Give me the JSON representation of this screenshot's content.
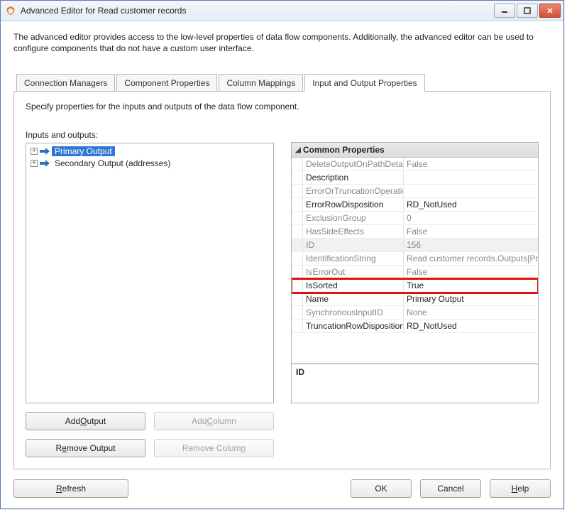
{
  "window": {
    "title": "Advanced Editor for Read customer records"
  },
  "intro": "The advanced editor provides access to the low-level properties of data flow components. Additionally, the advanced editor can be used to configure components that do not have a custom user interface.",
  "tabs": {
    "connection_managers": "Connection Managers",
    "component_properties": "Component Properties",
    "column_mappings": "Column Mappings",
    "io_properties": "Input and Output Properties"
  },
  "instruction": "Specify properties for the inputs and outputs of the data flow component.",
  "left": {
    "label": "Inputs and outputs:",
    "item0": "Primary Output",
    "item1": "Secondary Output (addresses)"
  },
  "propgrid": {
    "group": "Common Properties",
    "rows": {
      "DeleteOutputOnPathDetached": {
        "name": "DeleteOutputOnPathDetac",
        "value": "False"
      },
      "Description": {
        "name": "Description",
        "value": ""
      },
      "ErrorOrTruncationOperation": {
        "name": "ErrorOrTruncationOperatio",
        "value": ""
      },
      "ErrorRowDisposition": {
        "name": "ErrorRowDisposition",
        "value": "RD_NotUsed"
      },
      "ExclusionGroup": {
        "name": "ExclusionGroup",
        "value": "0"
      },
      "HasSideEffects": {
        "name": "HasSideEffects",
        "value": "False"
      },
      "ID": {
        "name": "ID",
        "value": "156"
      },
      "IdentificationString": {
        "name": "IdentificationString",
        "value": "Read customer records.Outputs[Pri"
      },
      "IsErrorOut": {
        "name": "IsErrorOut",
        "value": "False"
      },
      "IsSorted": {
        "name": "IsSorted",
        "value": "True"
      },
      "Name": {
        "name": "Name",
        "value": "Primary Output"
      },
      "SynchronousInputID": {
        "name": "SynchronousInputID",
        "value": "None"
      },
      "TruncationRowDisposition": {
        "name": "TruncationRowDisposition",
        "value": "RD_NotUsed"
      }
    },
    "desc_name": "ID"
  },
  "buttons": {
    "add_output_pre": "Add ",
    "add_output_u": "O",
    "add_output_post": "utput",
    "remove_output_pre": "R",
    "remove_output_u": "e",
    "remove_output_post": "move Output",
    "add_column_pre": "Add ",
    "add_column_u": "C",
    "add_column_post": "olumn",
    "remove_column_pre": "Remove Colum",
    "remove_column_u": "n",
    "remove_column_post": "",
    "refresh_pre": "",
    "refresh_u": "R",
    "refresh_post": "efresh",
    "ok": "OK",
    "cancel": "Cancel",
    "help_pre": "",
    "help_u": "H",
    "help_post": "elp"
  }
}
